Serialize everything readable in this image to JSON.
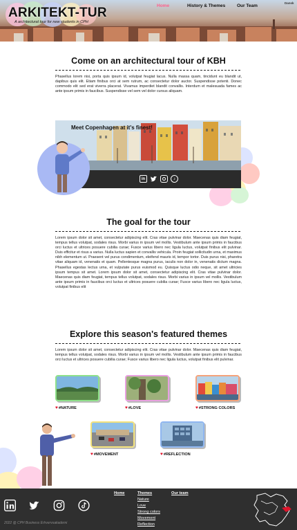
{
  "header": {
    "logo_text": "ARKITEKT-TUR",
    "tagline": "A architectural tour for new students in CPH",
    "nav": {
      "home": "Home",
      "history": "History & Themes",
      "team": "Our Team",
      "lang": "Dansk"
    },
    "colors": {
      "accent": "#ff5e8c"
    }
  },
  "intro": {
    "title": "Come on an architectural tour of KBH",
    "text": "Phasellus lorem nisi, porta quis ipsum id, volutpat feugiat lacus. Nulla massa quam, tincidunt eu blandit ut, dapibus quis elit. Etiam finibus orci at sem rutrum, ac consectetur dolor auctor. Suspendisse potenti. Donec commodo elit sed erat viverra placerat. Vivamus imperdiet blandit convallis. Interdum et malesuada fames ac ante ipsum primis in faucibus. Suspendisse vel sem vel dolor cursus aliquam."
  },
  "banner": {
    "title": "Meet Copenhagen at it's finest!",
    "social_icons": [
      "linkedin-icon",
      "twitter-icon",
      "instagram-icon",
      "tiktok-icon"
    ]
  },
  "goal": {
    "title": "The goal for the tour",
    "text": "Lorem ipsum dolor sit amet, consectetur adipiscing elit. Cras vitae pulvinar dolor. Maecenas quis diam feugiat, tempus tellus volutpat, sodales risus. Morbi varius in ipsum vel mollis. Vestibulum ante ipsum primis in faucibus orci luctus et ultrices posuere cubilia curae; Fusce varius libero nec ligula luctus, volutpat finibus elit pulvinar. Duis efficitur et risus a varius. Nulla luctus sapien et convallis vehicula. Proin feugiat sollicitudin urna, et maximus nibh elementum ut. Praesent vel purus condimentum, eleifend mauris id, tempor tortor. Duis purus nisi, pharetra vitae aliquam id, venenatis et quam. Pellentesque magna purus, iaculis non dolor in, venenatis dictum magna. Phasellus egestas lectus urna, et vulputate purus euismod eu. Quisque luctus odio neque, sit amet ultricies ipsum tempus sit amet. Lorem ipsum dolor sit amet, consectetur adipiscing elit. Cras vitae pulvinar dolor. Maecenas quis diam feugiat, tempus tellus volutpat, sodales risus. Morbi varius in ipsum vel mollis. Vestibulum ante ipsum primis in faucibus orci luctus et ultrices posuere cubilia curae; Fusce varius libero nec ligula luctus, volutpat finibus elit"
  },
  "themes": {
    "title": "Explore this season's featured themes",
    "text": "Lorem ipsum dolor sit amet, consectetur adipiscing elit. Cras vitae pulvinar dolor. Maecenas quis diam feugiat, tempus tellus volutpat, sodales risus. Morbi varius in ipsum vel mollis. Vestibulum ante ipsum primis in faucibus orci luctus et ultrices posuere cubilia curae; Fusce varius libero nec ligula luctus, volutpat finibus elit pulvinar.",
    "items": [
      {
        "label": "#NATURE",
        "border": "#8fe08a"
      },
      {
        "label": "#LOVE",
        "border": "#e8a0e0"
      },
      {
        "label": "#STRONG COLORS",
        "border": "#f4a27a"
      },
      {
        "label": "#MOVEMENT",
        "border": "#f3e27a"
      },
      {
        "label": "#REFLECTION",
        "border": "#8fb6f0"
      }
    ]
  },
  "footer": {
    "nav": {
      "home": "Home",
      "themes": "Themes",
      "team": "Our team",
      "theme_links": [
        "Nature",
        "Love",
        "Strong colors",
        "Movement",
        "Reflection"
      ]
    },
    "social_icons": [
      "linkedin-icon",
      "twitter-icon",
      "instagram-icon",
      "tiktok-icon"
    ],
    "copyright": "2022 @ CPH Business Erhvervsakademi"
  }
}
